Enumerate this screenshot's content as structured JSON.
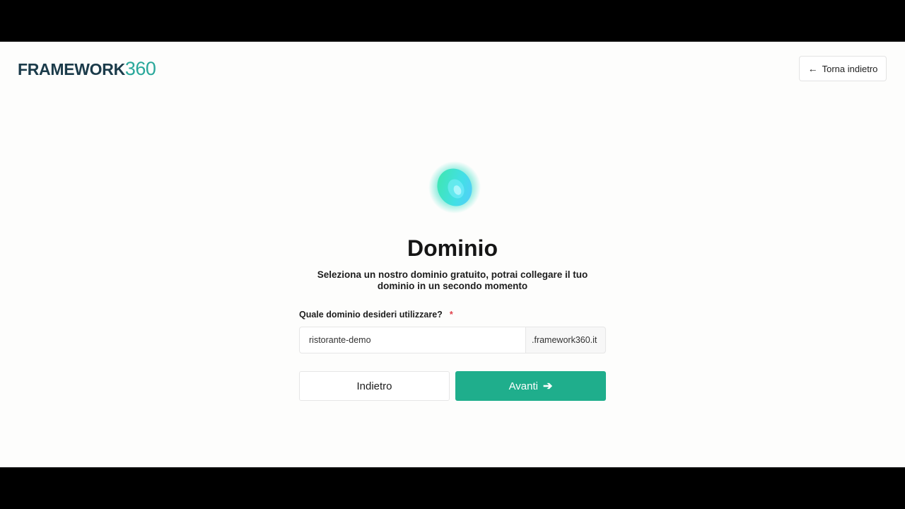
{
  "header": {
    "logo_main": "FRAMEWORK",
    "logo_number": "360",
    "back_label": "Torna indietro",
    "back_icon": "arrow-left-icon"
  },
  "hero": {
    "icon": "glowing-orb-icon",
    "title": "Dominio",
    "subtitle": "Seleziona un nostro dominio gratuito, potrai collegare il tuo dominio in un secondo momento"
  },
  "form": {
    "domain_label": "Quale dominio desideri utilizzare?",
    "required_mark": "*",
    "domain_value": "ristorante-demo",
    "domain_suffix": ".framework360.it"
  },
  "actions": {
    "prev_label": "Indietro",
    "next_label": "Avanti",
    "next_icon": "arrow-right-icon"
  },
  "colors": {
    "brand_dark": "#1b3b4a",
    "brand_teal": "#2aa89b",
    "primary_button": "#1fae8c",
    "required": "#e0404a"
  }
}
